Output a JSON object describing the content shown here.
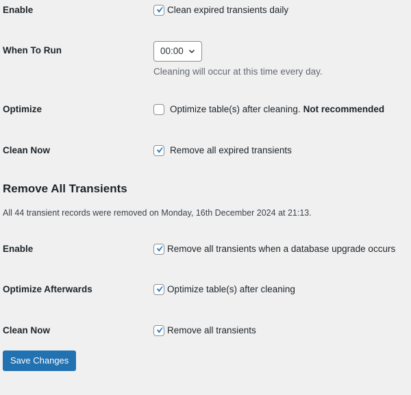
{
  "schedule": {
    "enable": {
      "label": "Enable",
      "checkbox_label": "Clean expired transients daily",
      "checked": true
    },
    "when_to_run": {
      "label": "When To Run",
      "selected_time": "00:00",
      "description": "Cleaning will occur at this time every day."
    },
    "optimize": {
      "label": "Optimize",
      "checkbox_label": "Optimize table(s) after cleaning.",
      "warning": "Not recommended",
      "checked": false
    },
    "clean_now": {
      "label": "Clean Now",
      "checkbox_label": "Remove all expired transients",
      "checked": true
    }
  },
  "remove_all": {
    "heading": "Remove All Transients",
    "status_note": "All 44 transient records were removed on Monday, 16th December 2024 at 21:13.",
    "enable": {
      "label": "Enable",
      "checkbox_label": "Remove all transients when a database upgrade occurs",
      "checked": true
    },
    "optimize_afterwards": {
      "label": "Optimize Afterwards",
      "checkbox_label": "Optimize table(s) after cleaning",
      "checked": true
    },
    "clean_now": {
      "label": "Clean Now",
      "checkbox_label": "Remove all transients",
      "checked": true
    }
  },
  "actions": {
    "save_label": "Save Changes"
  },
  "colors": {
    "background": "#f0f0f1",
    "accent": "#2271b1",
    "text": "#1d2327",
    "muted": "#646970"
  },
  "icons": {
    "checkmark": "checkmark-icon",
    "chevron": "chevron-down-icon"
  }
}
